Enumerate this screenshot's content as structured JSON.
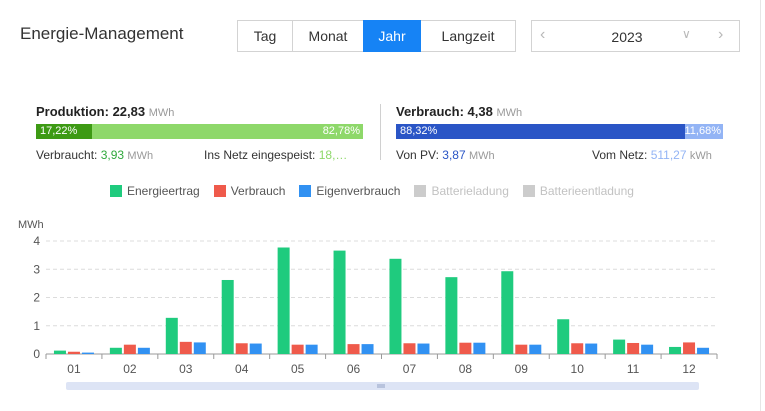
{
  "header": {
    "title": "Energie-Management",
    "tabs": [
      {
        "label": "Tag",
        "active": false
      },
      {
        "label": "Monat",
        "active": false
      },
      {
        "label": "Jahr",
        "active": true
      },
      {
        "label": "Langzeit",
        "active": false
      }
    ],
    "year": "2023"
  },
  "production": {
    "label": "Produktion:",
    "value": "22,83",
    "unit": "MWh",
    "bar_left_pct": "17,22%",
    "bar_right_pct": "82,78%",
    "self_used_share": 0.1722,
    "consumed_label": "Verbraucht:",
    "consumed_value": "3,93",
    "consumed_unit": "MWh",
    "grid_label": "Ins Netz eingespeist:",
    "grid_value": "18,…"
  },
  "consumption": {
    "label": "Verbrauch:",
    "value": "4,38",
    "unit": "MWh",
    "bar_left_pct": "88,32%",
    "bar_right_pct": "11,68%",
    "pv_share": 0.8832,
    "pv_label": "Von PV:",
    "pv_value": "3,87",
    "pv_unit": "MWh",
    "grid_label": "Vom Netz:",
    "grid_value": "511,27",
    "grid_unit": "kWh"
  },
  "colors": {
    "energieertrag": "#1fcb7e",
    "verbrauch": "#ef5a4b",
    "eigenverbrauch": "#3191f2",
    "disabled": "#cccccc",
    "prod_dark": "#3d9a14",
    "prod_light": "#8ed86a",
    "cons_dark": "#2a55c6",
    "cons_light": "#93b4f5"
  },
  "legend": [
    {
      "name": "Energieertrag",
      "color_key": "energieertrag",
      "enabled": true
    },
    {
      "name": "Verbrauch",
      "color_key": "verbrauch",
      "enabled": true
    },
    {
      "name": "Eigenverbrauch",
      "color_key": "eigenverbrauch",
      "enabled": true
    },
    {
      "name": "Batterieladung",
      "color_key": "disabled",
      "enabled": false
    },
    {
      "name": "Batterieentladung",
      "color_key": "disabled",
      "enabled": false
    }
  ],
  "chart_data": {
    "type": "bar",
    "ylabel": "MWh",
    "ylim": [
      0,
      4
    ],
    "yticks": [
      "0",
      "1",
      "2",
      "3",
      "4"
    ],
    "grid": true,
    "legend_position": "top",
    "categories": [
      "01",
      "02",
      "03",
      "04",
      "05",
      "06",
      "07",
      "08",
      "09",
      "10",
      "11",
      "12"
    ],
    "series": [
      {
        "name": "Energieertrag",
        "values": [
          0.12,
          0.22,
          1.28,
          2.62,
          3.77,
          3.66,
          3.37,
          2.72,
          2.93,
          1.23,
          0.51,
          0.25
        ]
      },
      {
        "name": "Verbrauch",
        "values": [
          0.08,
          0.33,
          0.43,
          0.38,
          0.33,
          0.35,
          0.38,
          0.4,
          0.33,
          0.38,
          0.39,
          0.41
        ]
      },
      {
        "name": "Eigenverbrauch",
        "values": [
          0.05,
          0.22,
          0.41,
          0.37,
          0.33,
          0.35,
          0.37,
          0.4,
          0.33,
          0.37,
          0.33,
          0.22
        ]
      }
    ]
  }
}
